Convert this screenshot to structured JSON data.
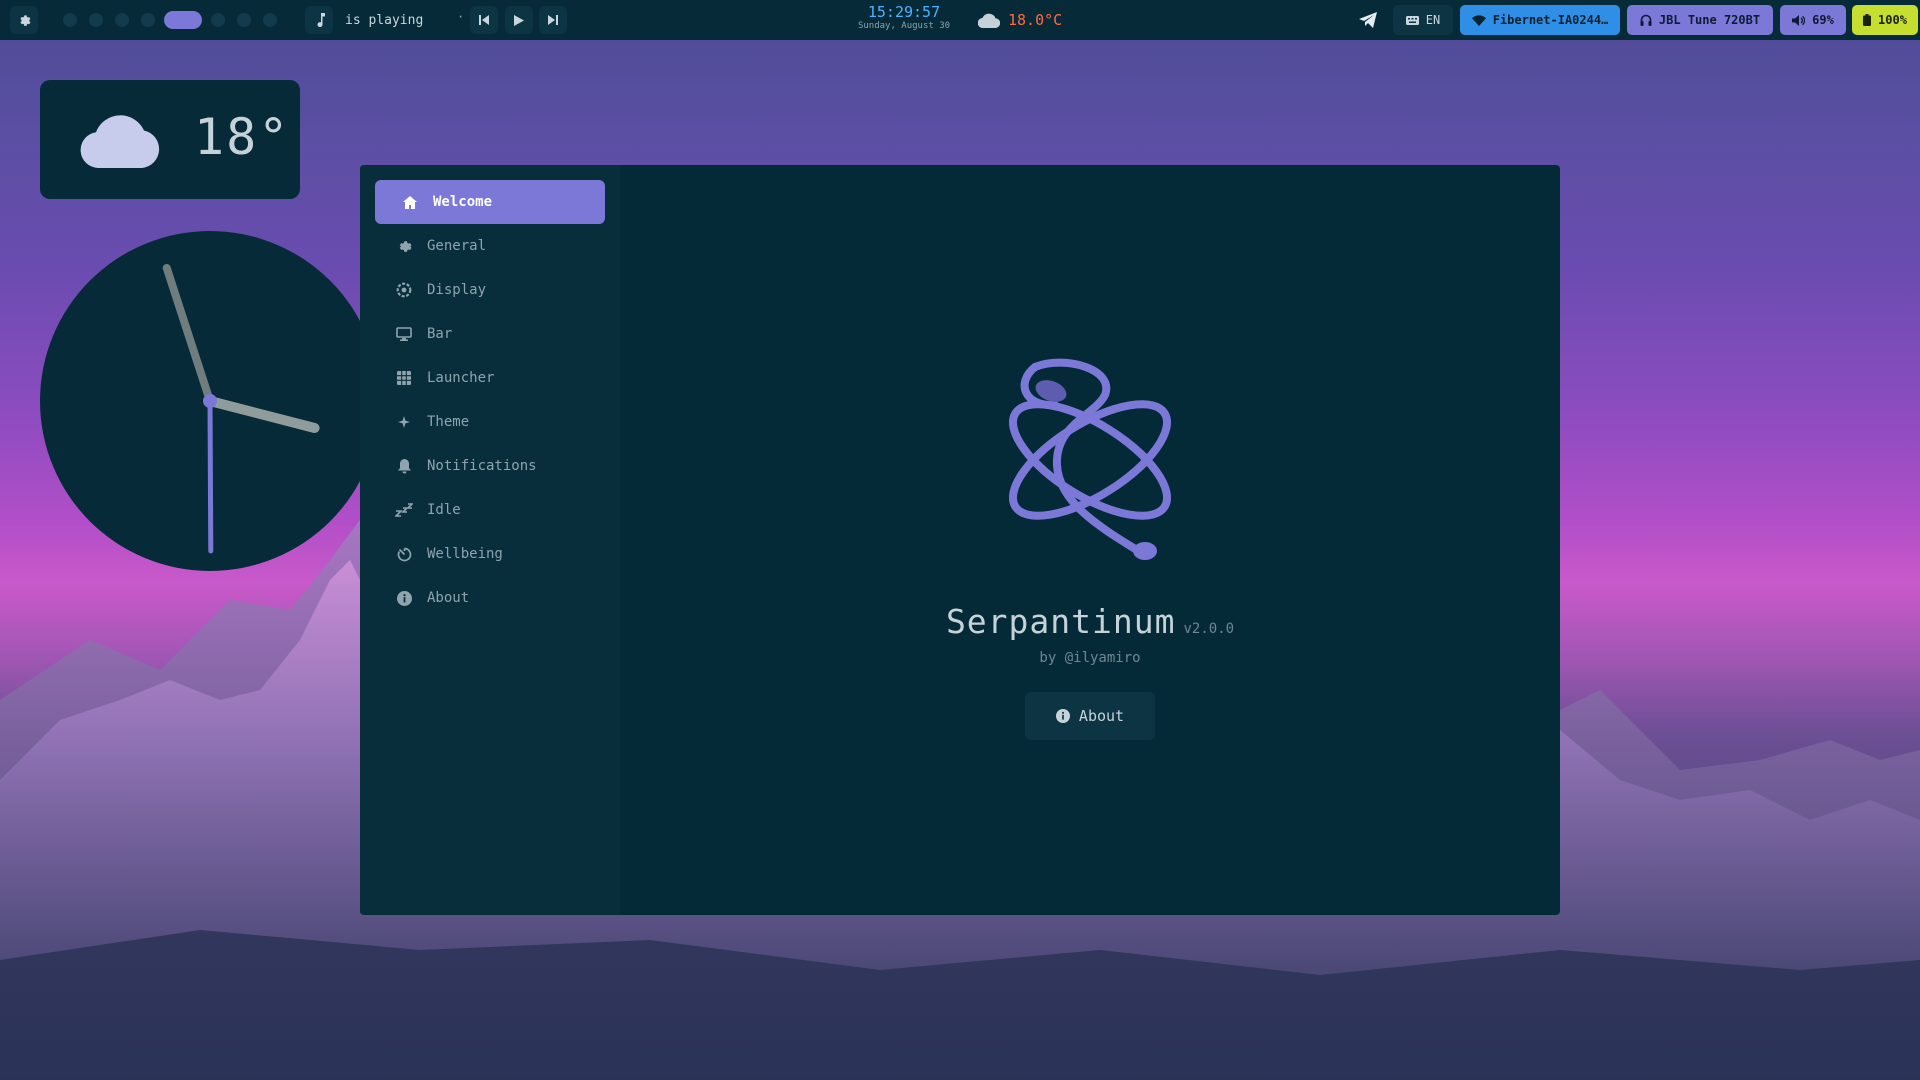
{
  "topbar": {
    "now_playing": "is playing",
    "now_playing_sep": "·",
    "time": "15:29:57",
    "date": "Sunday, August 30",
    "weather_temp": "18.0°C",
    "language": "EN",
    "wifi_name": "Fibernet-IA0244…",
    "bluetooth_device": "JBL Tune 720BT",
    "volume": "69%",
    "battery": "100%",
    "accent_colors": {
      "active": "#7b78d8",
      "wifi": "#2f8ee6",
      "battery": "#c5de2f",
      "time": "#4fb2ff",
      "temp": "#ff6b3d"
    }
  },
  "weather_widget": {
    "temp": "18°",
    "icon": "cloud-icon"
  },
  "clock_widget": {
    "hours": 3,
    "minutes": 29,
    "seconds": 57
  },
  "sidebar": {
    "items": [
      {
        "label": "Welcome",
        "icon": "home-icon",
        "active": true
      },
      {
        "label": "General",
        "icon": "gear-icon"
      },
      {
        "label": "Display",
        "icon": "display-gear-icon"
      },
      {
        "label": "Bar",
        "icon": "monitor-icon"
      },
      {
        "label": "Launcher",
        "icon": "grid-icon"
      },
      {
        "label": "Theme",
        "icon": "sparkle-icon"
      },
      {
        "label": "Notifications",
        "icon": "bell-icon"
      },
      {
        "label": "Idle",
        "icon": "zzz-icon"
      },
      {
        "label": "Wellbeing",
        "icon": "timer-icon"
      },
      {
        "label": "About",
        "icon": "info-icon"
      }
    ]
  },
  "welcome": {
    "app_name": "Serpantinum",
    "version": "v2.0.0",
    "author": "by @ilyamiro",
    "about_button": "About"
  }
}
